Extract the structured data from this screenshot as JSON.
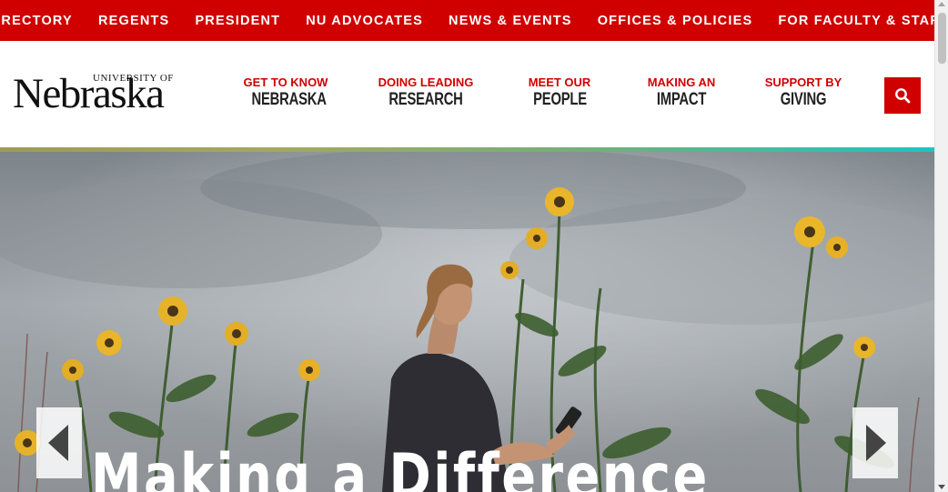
{
  "topbar": {
    "links": [
      "DIRECTORY",
      "REGENTS",
      "PRESIDENT",
      "NU ADVOCATES",
      "NEWS & EVENTS",
      "OFFICES & POLICIES",
      "FOR FACULTY & STAFF"
    ]
  },
  "logo": {
    "university_of": "UNIVERSITY OF",
    "name": "Nebraska"
  },
  "mainnav": [
    {
      "kicker": "GET TO KNOW",
      "main": "NEBRASKA"
    },
    {
      "kicker": "DOING LEADING",
      "main": "RESEARCH"
    },
    {
      "kicker": "MEET OUR",
      "main": "PEOPLE"
    },
    {
      "kicker": "MAKING AN",
      "main": "IMPACT"
    },
    {
      "kicker": "SUPPORT BY",
      "main": "GIVING"
    }
  ],
  "search": {
    "icon": "search-icon"
  },
  "hero": {
    "title": "Making a Difference",
    "prev_icon": "chevron-left-icon",
    "next_icon": "chevron-right-icon"
  },
  "colors": {
    "brand_red": "#d00000",
    "nav_text": "#222222",
    "gradient_start": "#9e9a5a",
    "gradient_end": "#1fc2c4"
  }
}
